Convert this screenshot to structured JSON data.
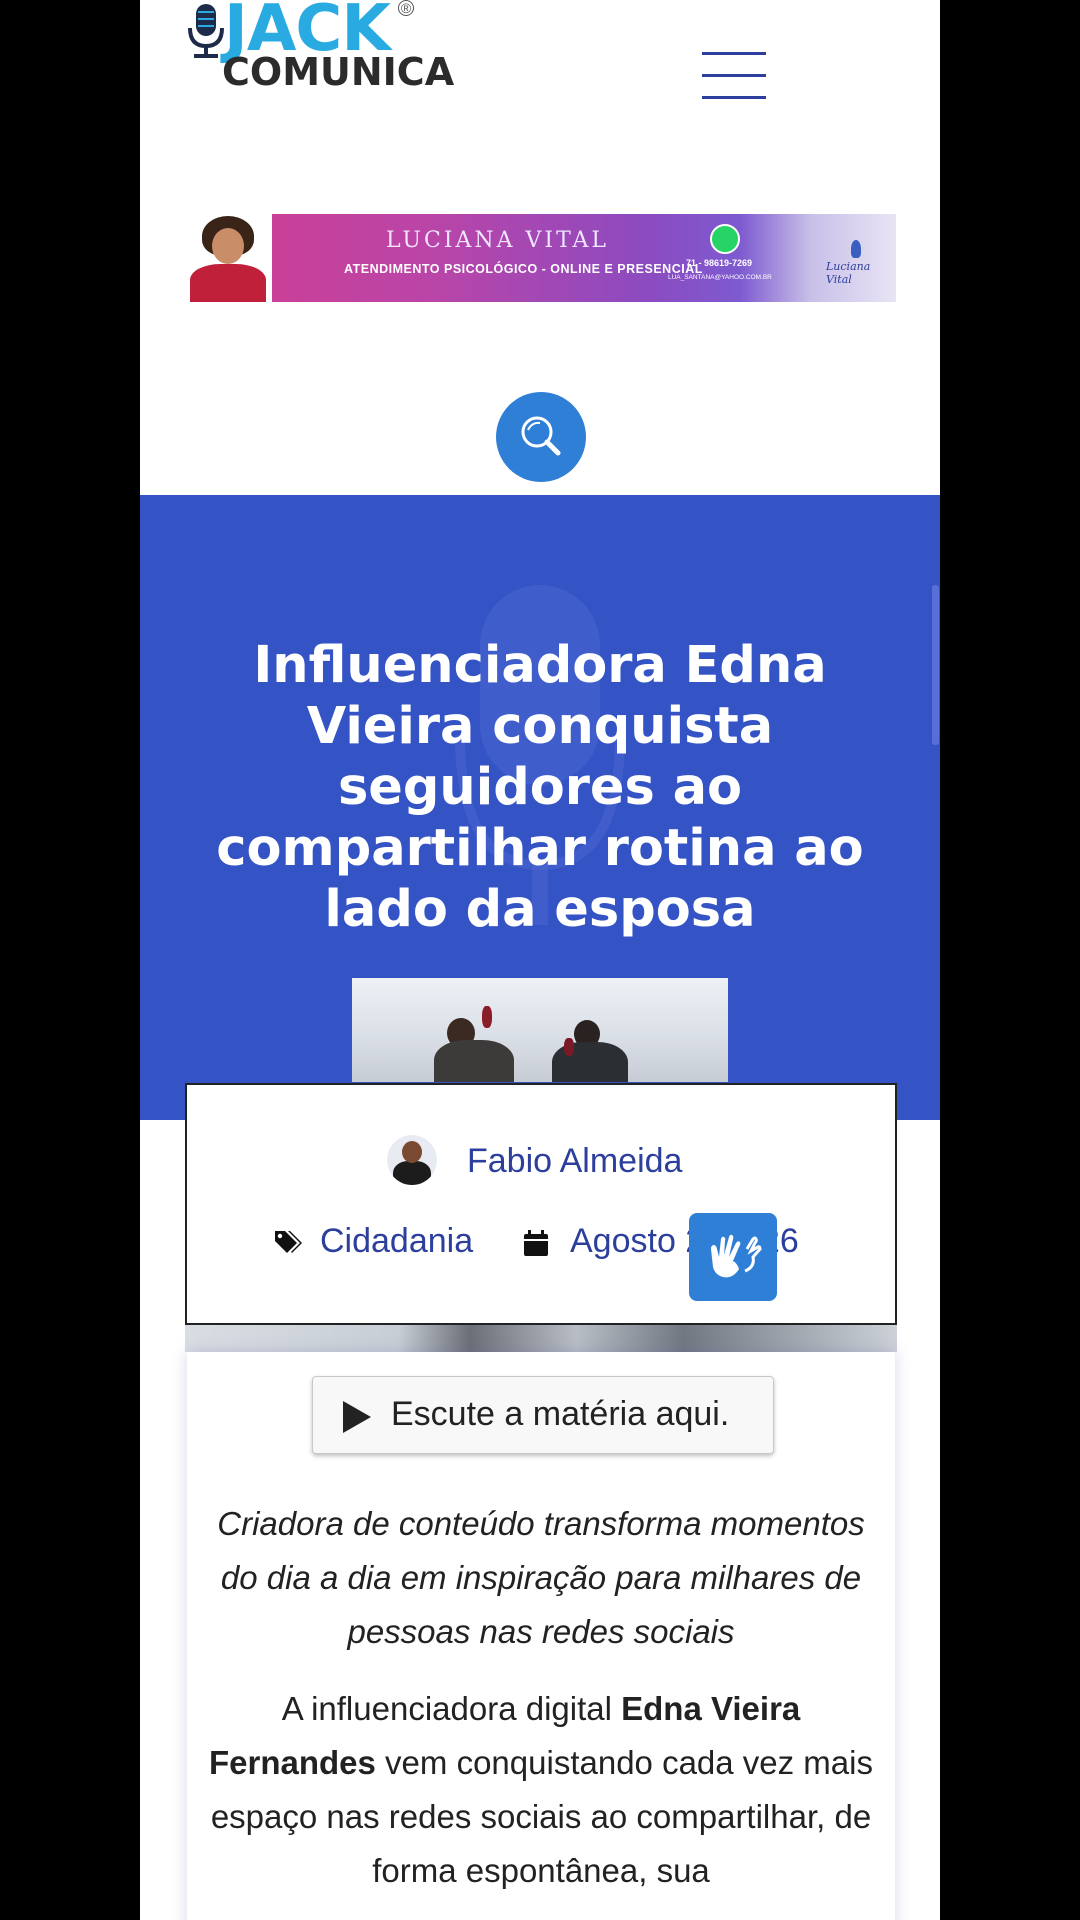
{
  "header": {
    "logo_top": "JACK",
    "logo_bottom": "COMUNICA",
    "logo_reg": "®",
    "menu_icon": "hamburger-menu-icon"
  },
  "ad": {
    "name": "LUCIANA VITAL",
    "subtitle": "ATENDIMENTO PSICOLÓGICO - ONLINE E PRESENCIAL",
    "phone": "71 - 98619-7269",
    "email": "LUA_SANTANA@YAHOO.COM.BR",
    "signature": "Luciana Vital",
    "icon": "whatsapp-icon"
  },
  "search": {
    "icon": "search-icon"
  },
  "article": {
    "title": "Influenciadora Edna Vieira conquista seguidores ao compartilhar rotina ao lado da esposa",
    "author": "Fabio Almeida",
    "category": "Cidadania",
    "date": "Agosto 2, 2026",
    "listen_label": "Escute a matéria aqui.",
    "subtitle": "Criadora de conteúdo transforma momentos do dia a dia em inspiração para milhares de pessoas nas redes sociais",
    "body_intro": "A influenciadora digital ",
    "body_bold": "Edna Vieira Fernandes",
    "body_rest": " vem conquistando cada vez mais espaço nas redes sociais ao compartilhar, de forma espontânea, sua"
  },
  "colors": {
    "hero_bg": "#3453c4",
    "link": "#2d3f9c",
    "accent_blue": "#2f7fd6"
  },
  "accessibility": {
    "icon": "sign-language-hands-icon"
  }
}
